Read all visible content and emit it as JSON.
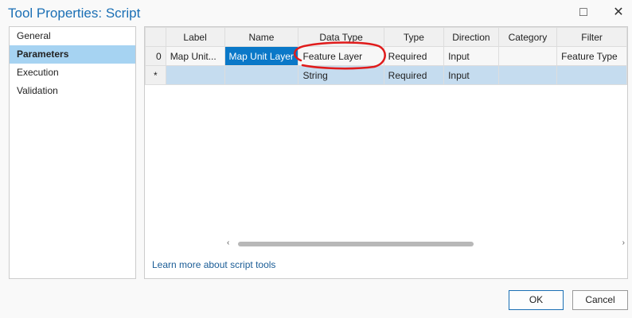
{
  "window": {
    "title": "Tool Properties: Script",
    "maximize_icon": "□",
    "close_icon": "✕"
  },
  "sidebar": {
    "items": [
      {
        "label": "General"
      },
      {
        "label": "Parameters"
      },
      {
        "label": "Execution"
      },
      {
        "label": "Validation"
      }
    ]
  },
  "grid": {
    "columns": [
      "",
      "Label",
      "Name",
      "Data Type",
      "Type",
      "Direction",
      "Category",
      "Filter"
    ],
    "rows": [
      [
        "0",
        "Map Unit...",
        "Map Unit Layer",
        "Feature Layer",
        "Required",
        "Input",
        "",
        "Feature Type"
      ],
      [
        "*",
        "",
        "",
        "String",
        "Required",
        "Input",
        "",
        ""
      ]
    ]
  },
  "link": "Learn more about script tools",
  "buttons": {
    "ok": "OK",
    "cancel": "Cancel"
  },
  "colors": {
    "accent": "#0a78c8",
    "annotation": "#e01b1b"
  }
}
